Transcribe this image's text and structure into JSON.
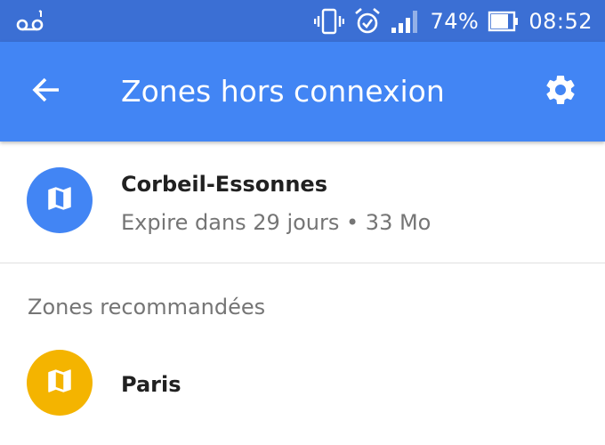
{
  "status_bar": {
    "battery_percent": "74%",
    "time": "08:52",
    "icons": [
      "voicemail-icon",
      "vibrate-icon",
      "alarm-icon",
      "signal-icon",
      "battery-icon"
    ]
  },
  "app_bar": {
    "title": "Zones hors connexion",
    "icons": [
      "back-arrow-icon",
      "gear-icon"
    ]
  },
  "downloaded_areas": [
    {
      "name": "Corbeil-Essonnes",
      "details": "Expire dans 29 jours • 33 Mo",
      "icon": "map-icon",
      "color": "#4285f4"
    }
  ],
  "recommended": {
    "header": "Zones recommandées",
    "items": [
      {
        "name": "Paris",
        "icon": "map-icon",
        "color": "#f4b400"
      }
    ]
  },
  "colors": {
    "status_bar": "#3b6fd4",
    "app_bar": "#4285f4",
    "accent_blue": "#4285f4",
    "accent_yellow": "#f4b400"
  }
}
